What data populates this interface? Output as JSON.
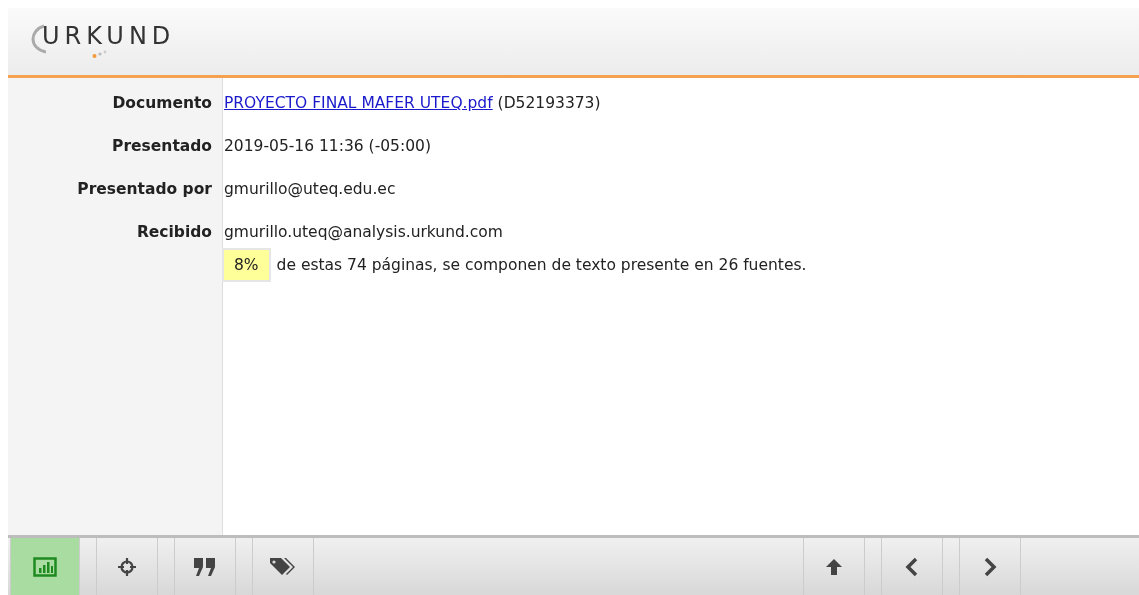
{
  "header": {
    "logo": "URKUND"
  },
  "details": [
    {
      "label": "Documento",
      "link": "PROYECTO FINAL MAFER UTEQ.pdf",
      "value": "(D52193373)"
    },
    {
      "label": "Presentado",
      "value": "2019-05-16 11:36 (-05:00)"
    },
    {
      "label": "Presentado por",
      "value": "gmurillo@uteq.edu.ec"
    },
    {
      "label": "Recibido",
      "value": "gmurillo.uteq@analysis.urkund.com"
    }
  ],
  "summary": {
    "percent": "8%",
    "text": "de estas 74 páginas, se componen de texto presente en 26 fuentes."
  },
  "toolbar": {
    "left": [
      {
        "kind": "chart",
        "selected": true
      },
      {
        "kind": "crosshair",
        "selected": false
      },
      {
        "kind": "quote",
        "selected": false
      },
      {
        "kind": "tags",
        "selected": false
      }
    ],
    "right": [
      {
        "kind": "up",
        "selected": false
      },
      {
        "kind": "prev",
        "selected": false
      },
      {
        "kind": "next",
        "selected": false
      }
    ]
  }
}
